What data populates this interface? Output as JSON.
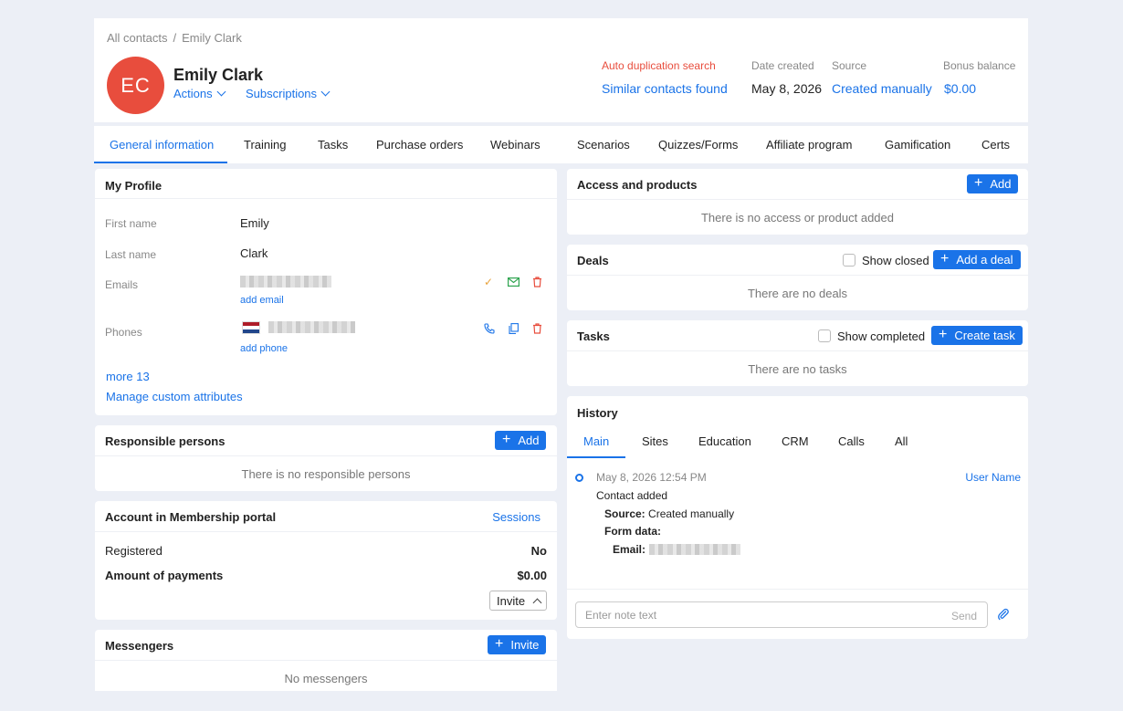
{
  "breadcrumb": {
    "root": "All contacts",
    "sep": "/",
    "current": "Emily Clark"
  },
  "contact": {
    "initials": "EC",
    "name": "Emily Clark",
    "avatar_color": "#e84d3d"
  },
  "header_links": {
    "actions": "Actions",
    "subscriptions": "Subscriptions"
  },
  "duplication": {
    "label": "Auto duplication search",
    "link": "Similar contacts found",
    "label_color": "#e84d3d"
  },
  "meta": {
    "date_label": "Date created",
    "date_value": "May 8, 2026",
    "source_label": "Source",
    "source_value": "Created manually",
    "bonus_label": "Bonus balance",
    "bonus_value": "$0.00"
  },
  "tabs": [
    "General information",
    "Training",
    "Tasks",
    "Purchase orders",
    "Webinars",
    "Scenarios",
    "Quizzes/Forms",
    "Affiliate program",
    "Gamification",
    "Certs"
  ],
  "profile": {
    "title": "My Profile",
    "first_name_label": "First name",
    "first_name": "Emily",
    "last_name_label": "Last name",
    "last_name": "Clark",
    "emails_label": "Emails",
    "add_email": "add email",
    "phones_label": "Phones",
    "add_phone": "add phone",
    "more": "more 13",
    "manage": "Manage custom attributes"
  },
  "responsible": {
    "title": "Responsible persons",
    "add": "Add",
    "empty": "There is no responsible persons"
  },
  "membership": {
    "title": "Account in Membership portal",
    "sessions": "Sessions",
    "registered_label": "Registered",
    "registered_value": "No",
    "payments_label": "Amount of payments",
    "payments_value": "$0.00",
    "invite": "Invite"
  },
  "messengers": {
    "title": "Messengers",
    "invite": "Invite",
    "empty": "No messengers"
  },
  "access": {
    "title": "Access and products",
    "add": "Add",
    "empty": "There is no access or product added"
  },
  "deals": {
    "title": "Deals",
    "show_closed": "Show closed",
    "add": "Add a deal",
    "empty": "There are no deals"
  },
  "tasks": {
    "title": "Tasks",
    "show_completed": "Show completed",
    "create": "Create task",
    "empty": "There are no tasks"
  },
  "history": {
    "title": "History",
    "tabs": [
      "Main",
      "Sites",
      "Education",
      "CRM",
      "Calls",
      "All"
    ],
    "entry": {
      "date": "May 8, 2026 12:54 PM",
      "user": "User Name",
      "event": "Contact added",
      "source_label": "Source:",
      "source_value": "Created manually",
      "form_label": "Form data:",
      "email_label": "Email:"
    },
    "note_placeholder": "Enter note text",
    "send": "Send"
  },
  "icons": [
    "chevron-down-icon",
    "check-icon",
    "mail-icon",
    "trash-icon",
    "phone-icon",
    "copy-icon",
    "flag-nl-icon",
    "plus-icon",
    "paperclip-icon",
    "chevron-up-icon"
  ],
  "colors": {
    "accent": "#1a73e8",
    "danger": "#e84d3d",
    "check": "#e8a33d",
    "mail": "#2ea44f"
  }
}
